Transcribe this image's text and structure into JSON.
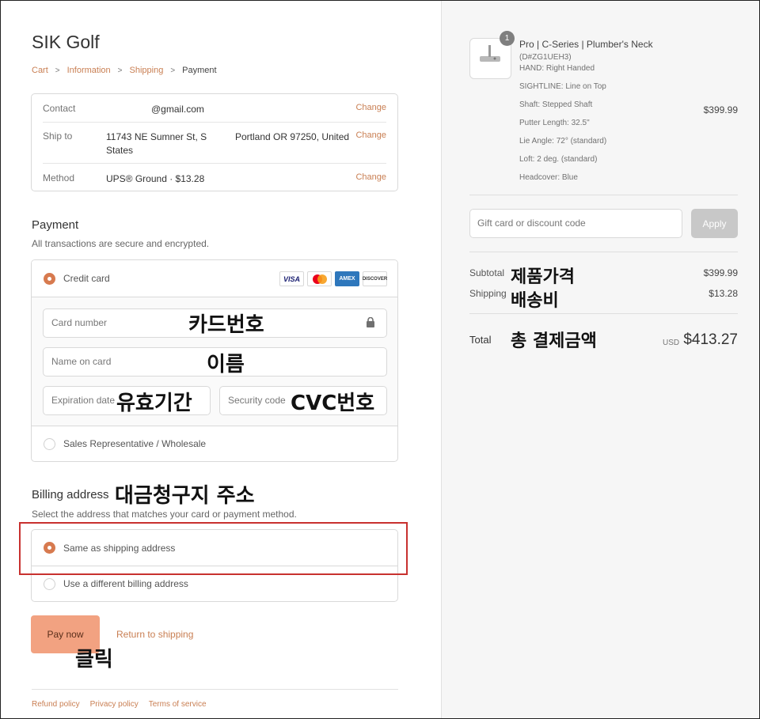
{
  "store": {
    "name": "SIK Golf"
  },
  "breadcrumb": {
    "cart": "Cart",
    "information": "Information",
    "shipping": "Shipping",
    "payment": "Payment"
  },
  "review": {
    "contact_label": "Contact",
    "contact_value": "@gmail.com",
    "shipto_label": "Ship to",
    "shipto_street": "11743 NE Sumner St, S States",
    "shipto_city": "Portland OR 97250, United",
    "method_label": "Method",
    "method_value": "UPS® Ground · $13.28",
    "change": "Change"
  },
  "payment": {
    "title": "Payment",
    "subtitle": "All transactions are secure and encrypted.",
    "credit_card_label": "Credit card",
    "card_brands": [
      "VISA",
      "MC",
      "AMEX",
      "DISCOVER"
    ],
    "card_number_placeholder": "Card number",
    "name_on_card_placeholder": "Name on card",
    "expiration_placeholder": "Expiration date",
    "security_placeholder": "Security code",
    "wholesale_label": "Sales Representative / Wholesale"
  },
  "billing": {
    "title": "Billing address",
    "subtitle": "Select the address that matches your card or payment method.",
    "same_label": "Same as shipping address",
    "different_label": "Use a different billing address"
  },
  "actions": {
    "pay_now": "Pay now",
    "return": "Return to shipping"
  },
  "footer": {
    "refund": "Refund policy",
    "privacy": "Privacy policy",
    "terms": "Terms of service"
  },
  "annotations": {
    "card_number": "카드번호",
    "name": "이름",
    "expiry": "유효기간",
    "cvc": "CVC번호",
    "billing": "대금청구지 주소",
    "click": "클릭",
    "subtotal": "제품가격",
    "shipping": "배송비",
    "total": "총 결제금액"
  },
  "order": {
    "quantity": "1",
    "product_name": "Pro | C-Series | Plumber's Neck",
    "details": [
      "(D#ZG1UEH3)",
      "HAND: Right Handed",
      "SIGHTLINE: Line on Top",
      "Shaft: Stepped Shaft",
      "Putter Length: 32.5\"",
      "Lie Angle: 72° (standard)",
      "Loft: 2 deg. (standard)",
      "Headcover: Blue"
    ],
    "price": "$399.99",
    "discount_placeholder": "Gift card or discount code",
    "apply": "Apply",
    "subtotal_label": "Subtotal",
    "subtotal_value": "$399.99",
    "shipping_label": "Shipping",
    "shipping_value": "$13.28",
    "total_label": "Total",
    "currency": "USD",
    "total_value": "$413.27"
  },
  "colors": {
    "accent": "#d77a4f",
    "link": "#c97f53",
    "pay_button": "#f2a281",
    "highlight": "#c8312f"
  }
}
